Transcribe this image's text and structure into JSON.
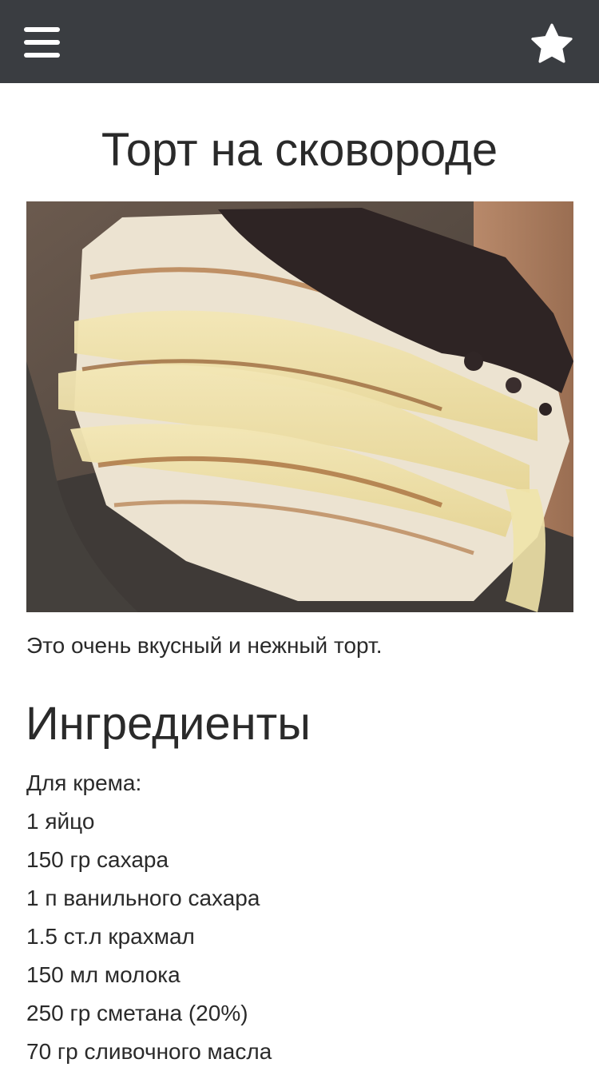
{
  "header": {
    "menu_icon": "hamburger-menu-icon",
    "favorite_icon": "star-icon",
    "background_color": "#3a3d41"
  },
  "recipe": {
    "title": "Торт на сковороде",
    "image_alt": "cake-slice-photo",
    "description": "Это очень вкусный и нежный торт."
  },
  "ingredients": {
    "heading": "Ингредиенты",
    "items": [
      "Для крема:",
      "1 яйцо",
      "150 гр сахара",
      "1 п ванильного сахара",
      "1.5 ст.л крахмал",
      "150 мл молока",
      "250 гр сметана (20%)",
      "70 гр сливочного масла"
    ]
  }
}
